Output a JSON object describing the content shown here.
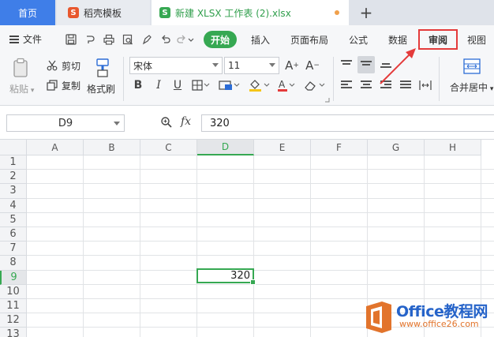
{
  "tabs": {
    "home": "首页",
    "template": "稻壳模板",
    "file": "新建 XLSX 工作表 (2).xlsx",
    "template_icon": "daoke-icon",
    "file_icon": "sheet-icon"
  },
  "menu": {
    "file": "文件",
    "items": [
      "开始",
      "插入",
      "页面布局",
      "公式",
      "数据",
      "审阅",
      "视图"
    ],
    "active": "开始",
    "highlighted": "审阅"
  },
  "ribbon": {
    "paste": "粘贴",
    "cut": "剪切",
    "copy": "复制",
    "format_painter": "格式刷",
    "font_name": "宋体",
    "font_size": "11",
    "merge_center": "合并居中"
  },
  "formula_bar": {
    "name_box": "D9",
    "fx": "fx",
    "value": "320"
  },
  "sheet": {
    "columns": [
      "A",
      "B",
      "C",
      "D",
      "E",
      "F",
      "G",
      "H"
    ],
    "rows": [
      "1",
      "2",
      "3",
      "4",
      "5",
      "6",
      "7",
      "8",
      "9",
      "10",
      "11",
      "12",
      "13"
    ],
    "selected_column": "D",
    "selected_row": "9",
    "selected_value": "320"
  },
  "watermark": {
    "title": "Office教程网",
    "subtitle": "www.office26.com"
  },
  "colors": {
    "accent_green": "#36a852",
    "home_tab_blue": "#3f7ee8",
    "annotation_red": "#e43b3b"
  }
}
